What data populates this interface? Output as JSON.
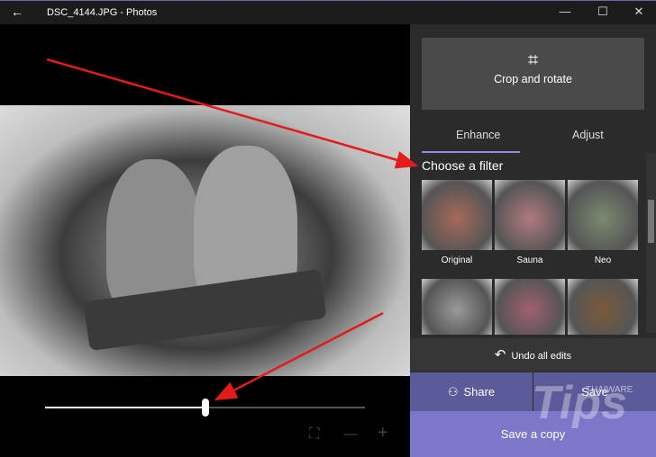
{
  "titlebar": {
    "title": "DSC_4144.JPG - Photos",
    "back": "←",
    "minimize": "—",
    "maximize": "☐",
    "close": "✕"
  },
  "panel": {
    "crop_label": "Crop and rotate",
    "crop_icon": "⌗",
    "tabs": [
      {
        "label": "Enhance",
        "selected": true
      },
      {
        "label": "Adjust",
        "selected": false
      }
    ],
    "filter_heading": "Choose a filter",
    "filters": [
      {
        "label": "Original",
        "color": "#a56a5a"
      },
      {
        "label": "Sauna",
        "color": "#b07a80"
      },
      {
        "label": "Neo",
        "color": "#7a8a70"
      },
      {
        "label": "",
        "color": "#9a9a9a"
      },
      {
        "label": "",
        "color": "#a06070"
      },
      {
        "label": "",
        "color": "#7a5a3a"
      }
    ],
    "undo_label": "Undo all edits",
    "undo_icon": "↶",
    "share_label": "Share",
    "share_icon": "⚇",
    "save_label": "Save",
    "save_copy_label": "Save a copy"
  },
  "slider": {
    "value": 0.5
  },
  "bottom_icons": {
    "fit": "⛶",
    "zoom_out": "—",
    "zoom_in": "+"
  },
  "watermark": {
    "text": "Tips",
    "brand": "THAIWARE"
  }
}
